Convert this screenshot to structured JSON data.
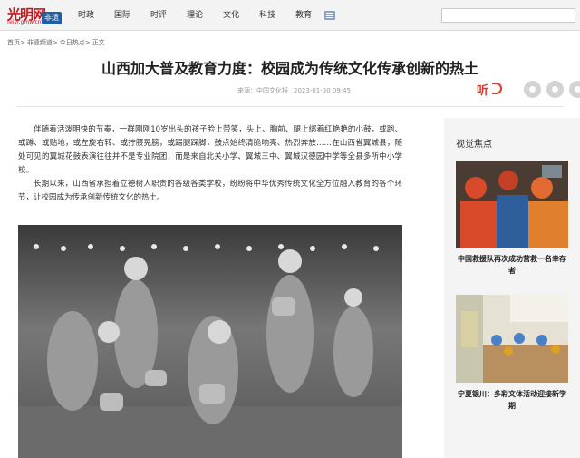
{
  "logo": {
    "name": "光明网",
    "url_text": "feiyi.gmw.cn",
    "badge": "非遗"
  },
  "nav": {
    "items": [
      "时政",
      "国际",
      "时评",
      "理论",
      "文化",
      "科技",
      "教育"
    ]
  },
  "search": {
    "placeholder": ""
  },
  "breadcrumb": [
    "首页>",
    "非遗频道>",
    "今日热点>",
    "正文"
  ],
  "article": {
    "title": "山西加大普及教育力度：校园成为传统文化传承创新的热土",
    "source": "来源：中国文化报",
    "date": "2023-01-30 09:45",
    "listen_label": "听",
    "paragraphs": [
      "伴随着活泼明快的节奏，一群刚刚10岁出头的孩子脸上带笑，头上、胸前、腿上绑着红艳艳的小鼓，或跑、或蹲、或贴地，或左旋右转、或拧腰晃膀，或踢腿踩脚，鼓点始终清脆响亮、热烈奔放……在山西省翼城县，随处可见的翼城花鼓表演往往并不是专业院团，而是来自北关小学、翼城三中、翼城汉德园中学等全县多所中小学校。",
      "长期以来，山西省承担着立德树人职责的各级各类学校，纷纷将中华优秀传统文化全方位融入教育的各个环节，让校园成为传承创新传统文化的热土。"
    ]
  },
  "sidebar": {
    "title": "视觉焦点",
    "items": [
      {
        "caption": "中国救援队再次成功营救一名幸存者"
      },
      {
        "caption": "宁夏银川：多彩文体活动迎接新学期"
      }
    ]
  }
}
